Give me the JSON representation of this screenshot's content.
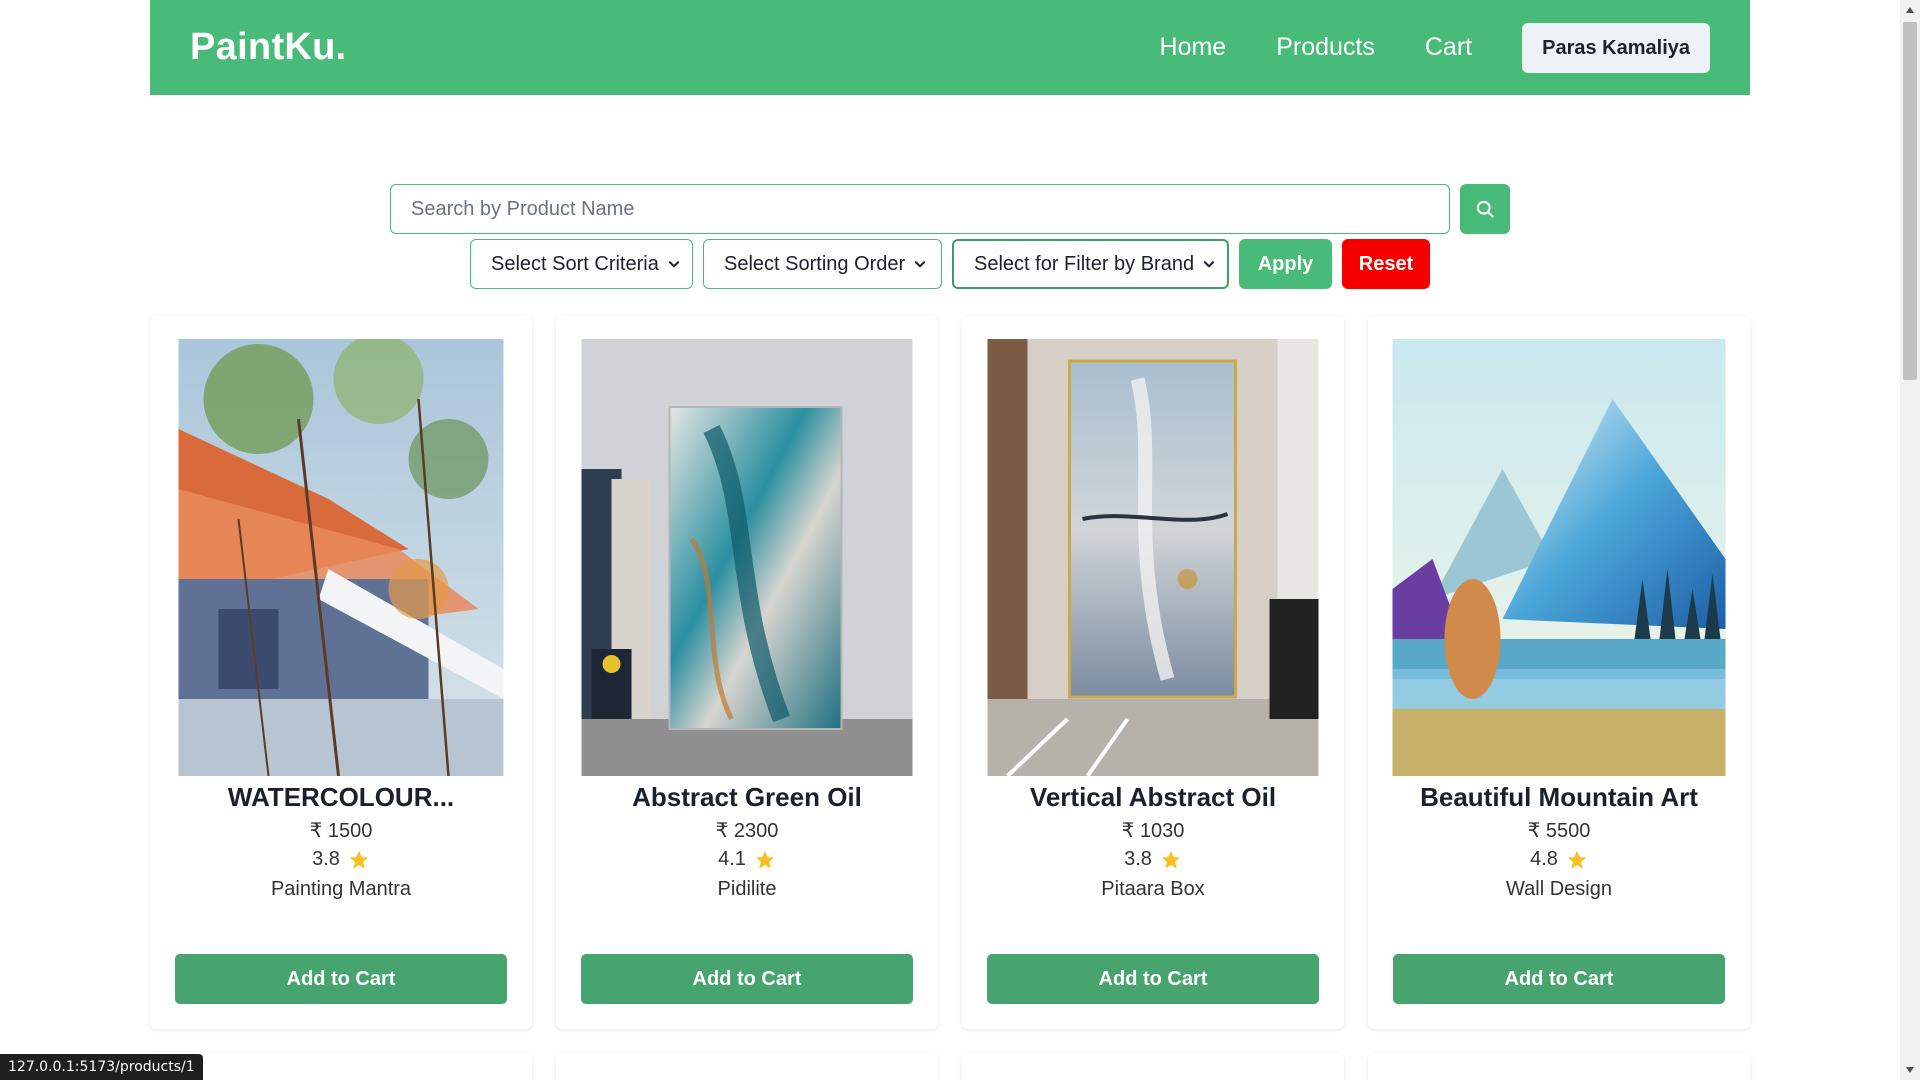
{
  "navbar": {
    "brand": "PaintKu.",
    "links": [
      "Home",
      "Products",
      "Cart"
    ],
    "user": "Paras Kamaliya"
  },
  "search": {
    "placeholder": "Search by Product Name",
    "icon": "search-icon"
  },
  "filters": {
    "sort_criteria": "Select Sort Criteria",
    "sort_order": "Select Sorting Order",
    "brand": "Select for Filter by Brand",
    "apply": "Apply",
    "reset": "Reset"
  },
  "products": [
    {
      "title": "WATERCOLOUR...",
      "price": "₹ 1500",
      "rating": "3.8",
      "brand": "Painting Mantra",
      "button": "Add to Cart"
    },
    {
      "title": "Abstract Green Oil",
      "price": "₹ 2300",
      "rating": "4.1",
      "brand": "Pidilite",
      "button": "Add to Cart"
    },
    {
      "title": "Vertical Abstract Oil",
      "price": "₹ 1030",
      "rating": "3.8",
      "brand": "Pitaara Box",
      "button": "Add to Cart"
    },
    {
      "title": "Beautiful Mountain Art",
      "price": "₹ 5500",
      "rating": "4.8",
      "brand": "Wall Design",
      "button": "Add to Cart"
    }
  ],
  "colors": {
    "primary": "#48bb78",
    "reset": "#f40000",
    "star": "#fbbf24"
  },
  "status_url": "127.0.0.1:5173/products/1"
}
